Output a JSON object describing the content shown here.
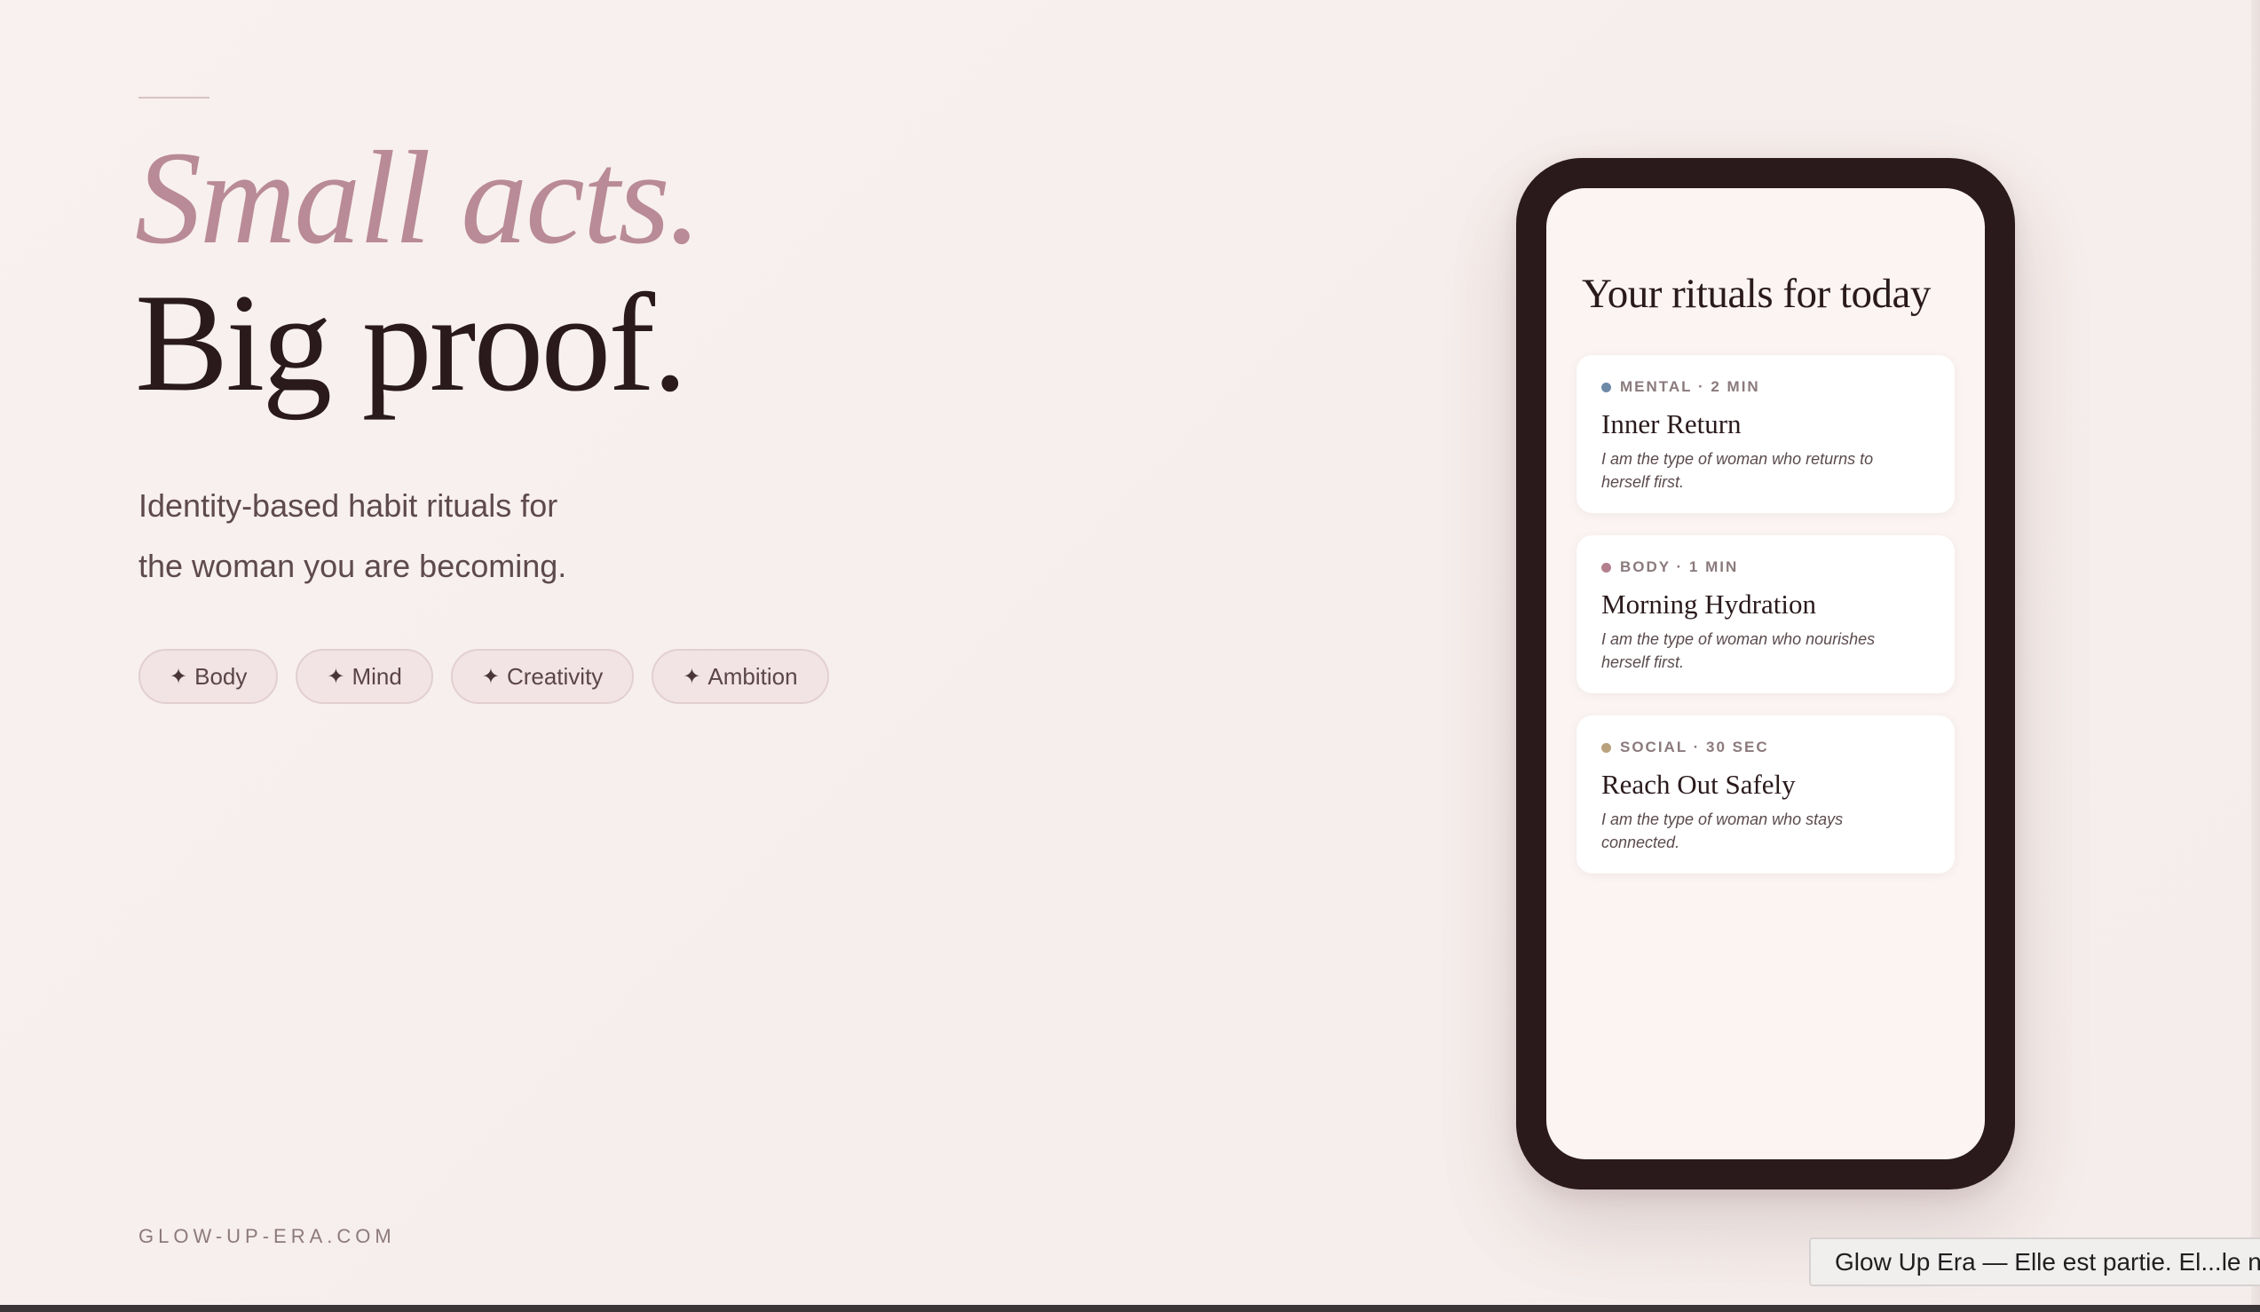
{
  "hero": {
    "headline_italic": "Small acts.",
    "headline_main": "Big proof.",
    "subtitle_line1": "Identity-based habit rituals for",
    "subtitle_line2": "the woman you are becoming.",
    "tags": [
      {
        "label": "Body",
        "icon": "sparkle-icon"
      },
      {
        "label": "Mind",
        "icon": "sparkle-icon"
      },
      {
        "label": "Creativity",
        "icon": "sparkle-icon"
      },
      {
        "label": "Ambition",
        "icon": "sparkle-icon"
      }
    ],
    "star_glyph": "✦"
  },
  "footer": {
    "url": "GLOW-UP-ERA.COM"
  },
  "phone": {
    "title": "Your rituals for today",
    "cards": [
      {
        "category": "MENTAL · 2 MIN",
        "dot_color": "#6f8aa6",
        "title": "Inner Return",
        "description": "I am the type of woman who returns to herself first."
      },
      {
        "category": "BODY · 1 MIN",
        "dot_color": "#b47f8d",
        "title": "Morning Hydration",
        "description": "I am the type of woman who nourishes herself first."
      },
      {
        "category": "SOCIAL · 30 SEC",
        "dot_color": "#b9a17d",
        "title": "Reach Out Safely",
        "description": "I am the type of woman who stays connected."
      }
    ]
  },
  "tooltip": {
    "text": "Glow Up Era — Elle est partie. El...le n"
  },
  "colors": {
    "accent_rose": "#b98a97",
    "ink": "#2a1a1c",
    "phone_frame": "#2b1a1b",
    "background": "#f7efed"
  }
}
